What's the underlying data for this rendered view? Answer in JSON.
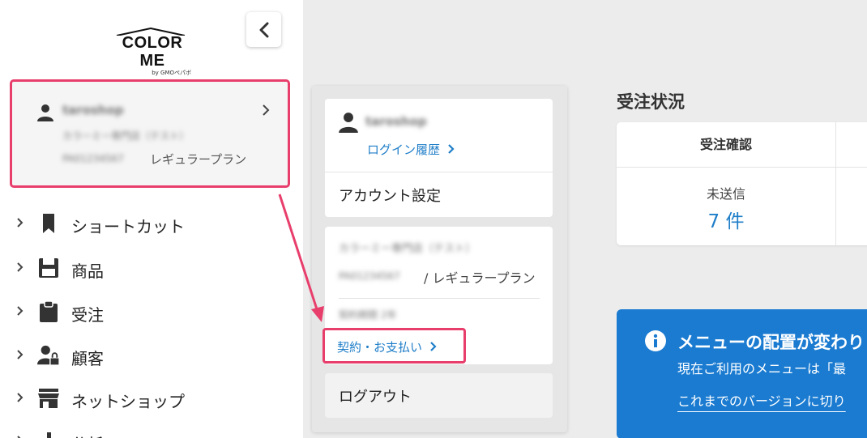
{
  "logo": {
    "main": "COLOR ME",
    "sub": "by GMOペパボ"
  },
  "sidebar": {
    "account": {
      "name": "taroshop",
      "shop": "カラーミー専門店（テスト）",
      "id": "PA01234567",
      "plan": "レギュラープラン"
    },
    "items": [
      {
        "label": "ショートカット",
        "icon": "bookmark-icon"
      },
      {
        "label": "商品",
        "icon": "save-icon"
      },
      {
        "label": "受注",
        "icon": "clipboard-icon"
      },
      {
        "label": "顧客",
        "icon": "user-lock-icon"
      },
      {
        "label": "ネットショップ",
        "icon": "store-icon"
      },
      {
        "label": "分析",
        "icon": "chart-icon"
      }
    ]
  },
  "popover": {
    "name": "taroshop",
    "login_history": "ログイン履歴",
    "account_settings": "アカウント設定",
    "shop": "カラーミー専門店（テスト）",
    "id": "PA01234567",
    "plan": "/ レギュラープラン",
    "contract_info": "契約期間 2年",
    "contract_link": "契約・お支払い",
    "logout": "ログアウト"
  },
  "orders": {
    "title": "受注状況",
    "column_header": "受注確認",
    "status_label": "未送信",
    "count": "7 件"
  },
  "notice": {
    "title": "メニューの配置が変わり",
    "line1": "現在ご利用のメニューは「最",
    "line2": "これまでのバージョンに切り"
  },
  "colors": {
    "accent": "#1f7ec8",
    "highlight": "#e83e6c",
    "notice_bg": "#1a7bd1"
  }
}
